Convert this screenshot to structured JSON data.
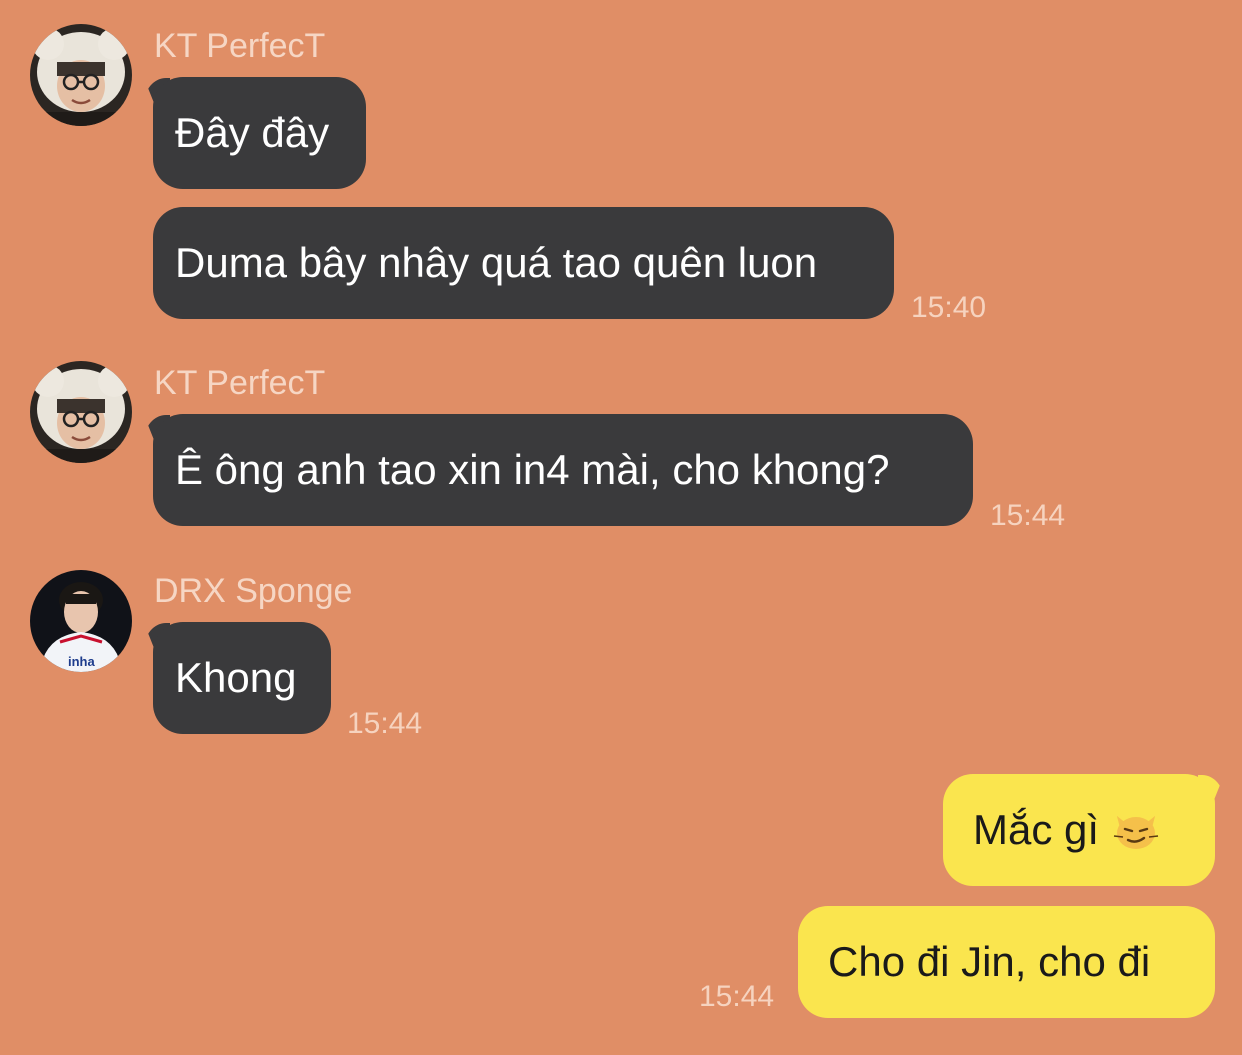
{
  "messages": [
    {
      "sender": "KT PerfecT",
      "texts": [
        "Đây đây",
        "Duma bây nhây quá tao quên luon"
      ],
      "time": "15:40"
    },
    {
      "sender": "KT PerfecT",
      "texts": [
        "Ê ông anh tao xin in4 mài, cho khong?"
      ],
      "time": "15:44"
    },
    {
      "sender": "DRX Sponge",
      "texts": [
        "Khong"
      ],
      "time": "15:44"
    }
  ],
  "outgoing": {
    "texts": [
      "Mắc gì",
      "Cho đi Jin, cho đi"
    ],
    "emoji": "smirking-cat-emoji",
    "time": "15:44"
  },
  "colors": {
    "background": "#E08E66",
    "incoming_bubble": "#3A3A3C",
    "outgoing_bubble": "#FAE54E"
  }
}
